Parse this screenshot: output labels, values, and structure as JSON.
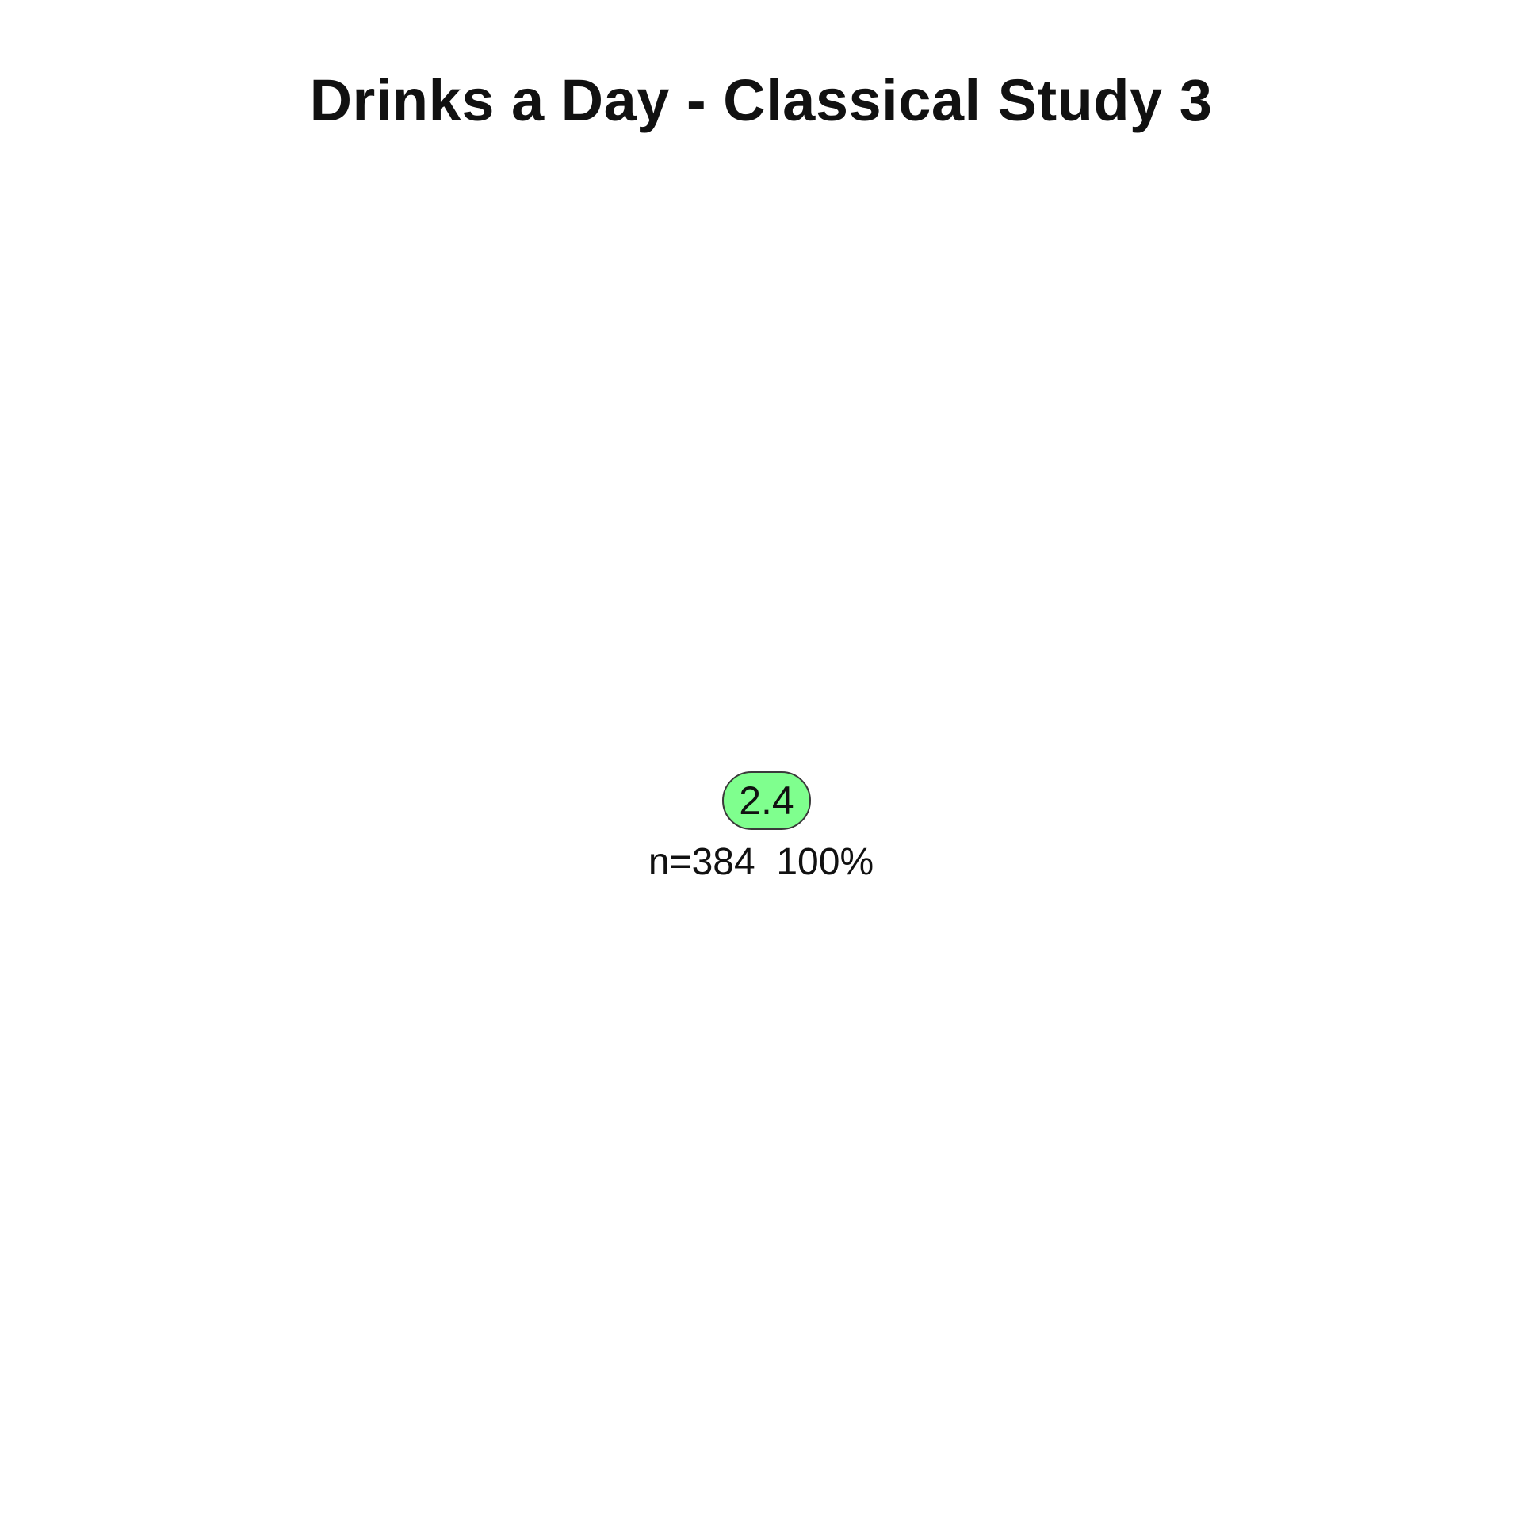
{
  "title": "Drinks a Day - Classical Study 3",
  "tree": {
    "root": {
      "value": "2.4",
      "n_label": "n=384",
      "percent_label": "100%",
      "fill_color": "#7fff8e"
    }
  }
}
